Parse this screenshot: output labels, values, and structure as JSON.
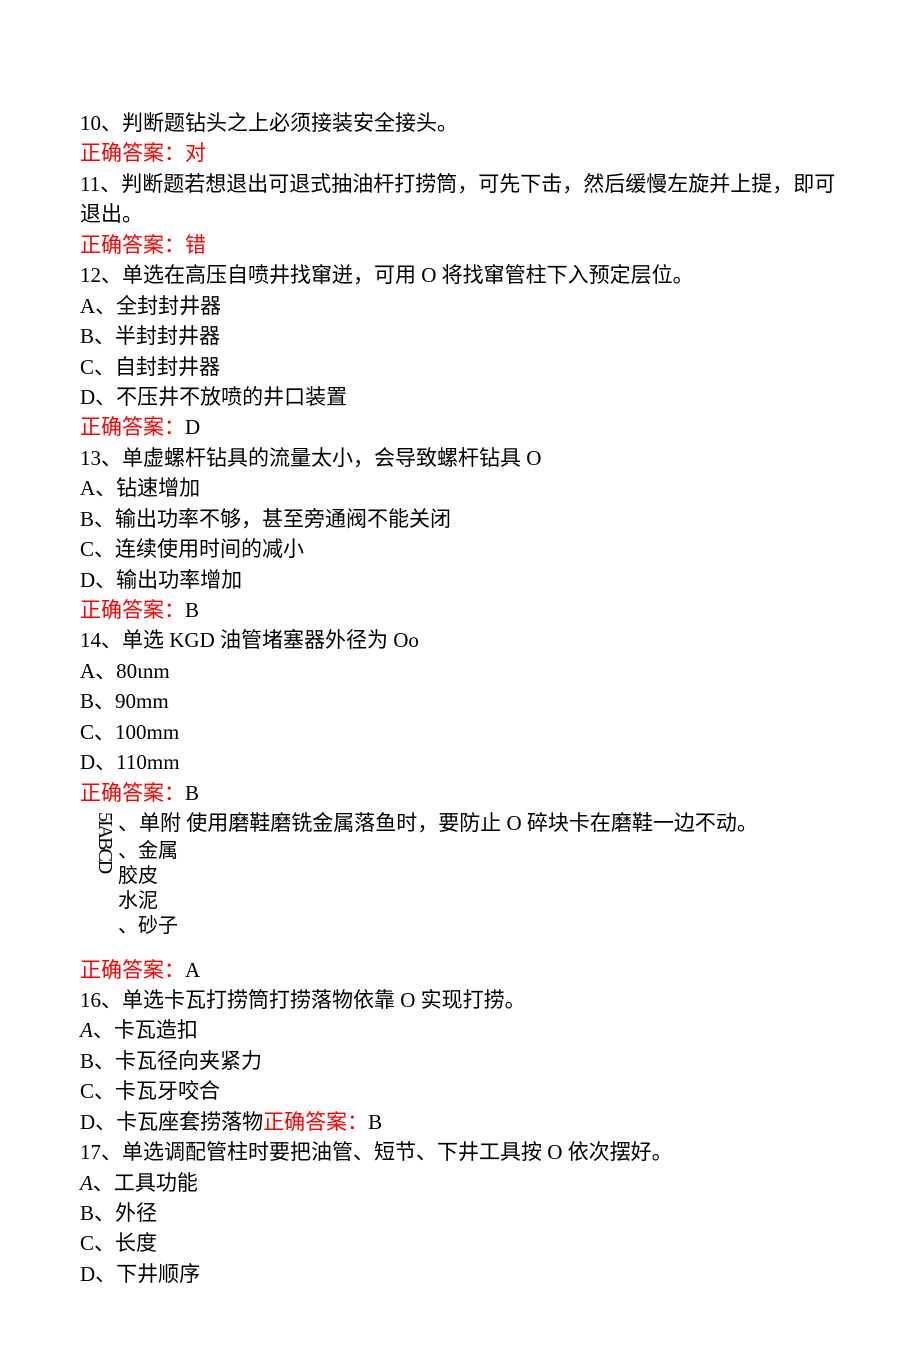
{
  "q10": {
    "text": "10、判断题钻头之上必须接装安全接头。",
    "answer_label": "正确答案：",
    "answer_value": "对"
  },
  "q11": {
    "text": "11、判断题若想退出可退式抽油杆打捞筒，可先下击，然后缓慢左旋并上提，即可退出。",
    "answer_label": "正确答案：",
    "answer_value": "错"
  },
  "q12": {
    "text": "12、单选在高压自喷井找窜迸，可用 O 将找窜管柱下入预定层位。",
    "optA": "A、全封封井器",
    "optB": "B、半封封井器",
    "optC": "C、自封封井器",
    "optD": "D、不压井不放喷的井口装置",
    "answer_label": "正确答案：",
    "answer_value": "D"
  },
  "q13": {
    "text": "13、单虚螺杆钻具的流量太小，会导致螺杆钻具 O",
    "optA": "A、钻速增加",
    "optB": "B、输出功率不够，甚至旁通阀不能关闭",
    "optC": "C、连续使用时间的减小",
    "optD": "D、输出功率增加",
    "answer_label": "正确答案：",
    "answer_value": "B"
  },
  "q14": {
    "text": "14、单选 KGD 油管堵塞器外径为 Oo",
    "optA": "A、80ιnm",
    "optB": "B、90mm",
    "optC": "C、100mm",
    "optD": "D、110mm",
    "answer_label": "正确答案：",
    "answer_value": "B"
  },
  "q15": {
    "sideways": "5IABCD",
    "stem_prefix": "、单附",
    "stem_rest": "  使用磨鞋磨铣金属落鱼时，要防止 O 碎块卡在磨鞋一边不动。",
    "optA": "、金属",
    "optB": "  胶皮",
    "optC": "  水泥",
    "optD": "、砂子",
    "answer_label": "正确答案：",
    "answer_value": "A"
  },
  "q16": {
    "text": "16、单选卡瓦打捞筒打捞落物依靠 O 实现打捞。",
    "optA_prefix": "A",
    "optA_rest": "、卡瓦造扣",
    "optB": "B、卡瓦径向夹紧力",
    "optC": "C、卡瓦牙咬合",
    "optD": "D、卡瓦座套捞落物",
    "answer_label": "正确答案：",
    "answer_value": "B"
  },
  "q17": {
    "text": "17、单选调配管柱时要把油管、短节、下井工具按 O 依次摆好。",
    "optA_prefix": "A",
    "optA_rest": "、工具功能",
    "optB": "B、外径",
    "optC": "C、长度",
    "optD": "D、下井顺序"
  }
}
